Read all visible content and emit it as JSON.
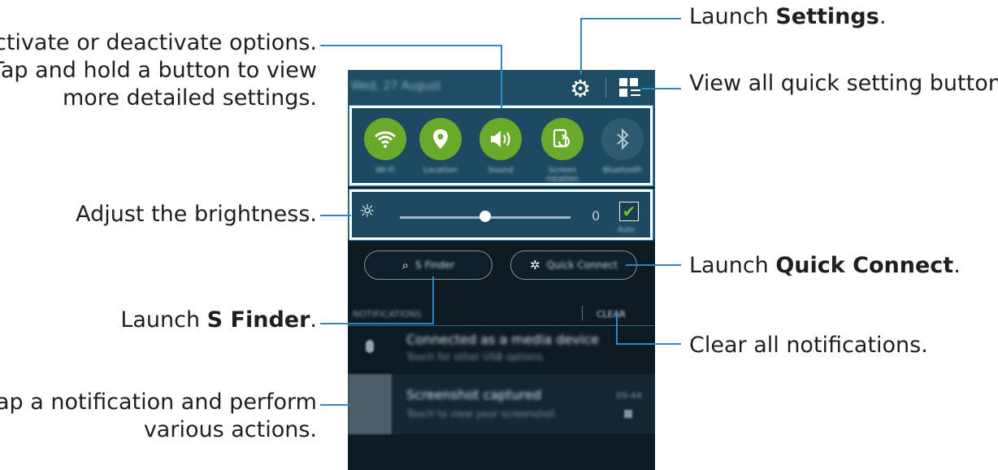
{
  "callouts": {
    "options_line1": "Activate or deactivate options.",
    "options_line2": "Tap and hold a button to view",
    "options_line3": "more detailed settings.",
    "brightness": "Adjust the brightness.",
    "sfinder_prefix": "Launch ",
    "sfinder_bold": "S Finder",
    "sfinder_suffix": ".",
    "notification_line1": "Tap a notification and perform",
    "notification_line2": "various actions.",
    "settings_prefix": "Launch ",
    "settings_bold": "Settings",
    "settings_suffix": ".",
    "quick_settings": "View all quick setting buttons.",
    "quickconnect_prefix": "Launch ",
    "quickconnect_bold": "Quick Connect",
    "quickconnect_suffix": ".",
    "clear": "Clear all notifications."
  },
  "panel": {
    "date": "Wed, 27 August",
    "quick_buttons": [
      {
        "label": "Wi-Fi",
        "icon": "wifi-icon",
        "color": "#6aaa2a"
      },
      {
        "label": "Location",
        "icon": "location-icon",
        "color": "#6aaa2a"
      },
      {
        "label": "Sound",
        "icon": "sound-icon",
        "color": "#6aaa2a"
      },
      {
        "label": "Screen rotation",
        "icon": "rotation-icon",
        "color": "#6aaa2a"
      },
      {
        "label": "Bluetooth",
        "icon": "bluetooth-icon",
        "color": "#2f5b70"
      }
    ],
    "brightness": {
      "value_text": "0",
      "level": 0.5,
      "auto_label": "Auto",
      "auto_checked": true
    },
    "s_finder": "S Finder",
    "quick_connect": "Quick Connect",
    "notifications_title": "NOTIFICATIONS",
    "clear_label": "CLEAR",
    "notifications": [
      {
        "title": "Connected as a media device",
        "subtitle": "Touch for other USB options."
      },
      {
        "title": "Screenshot captured",
        "subtitle": "Touch to view your screenshot.",
        "time": "09:44"
      }
    ]
  },
  "colors": {
    "accent_line": "#2f86c4",
    "toggle_on": "#6aaa2a",
    "panel_bg": "#1d4a60"
  }
}
